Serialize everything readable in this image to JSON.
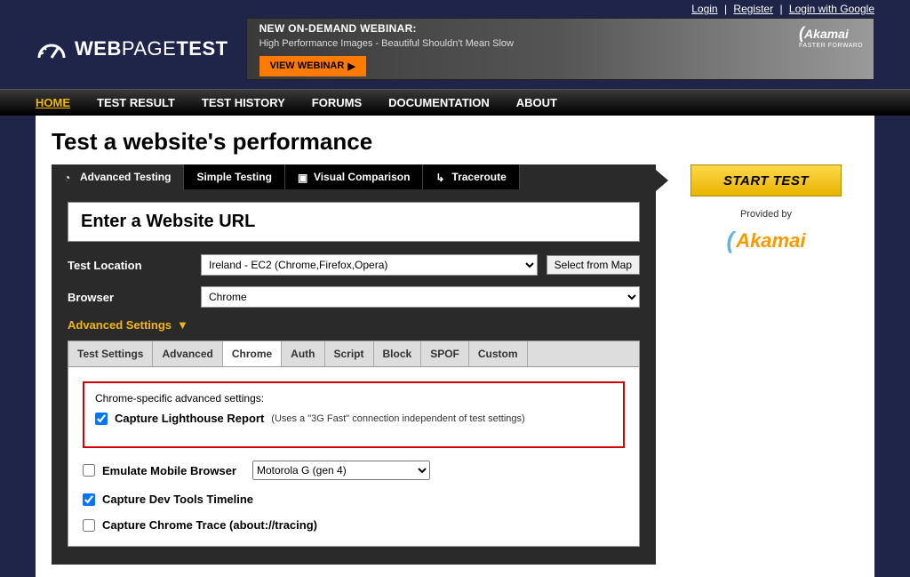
{
  "toplinks": {
    "login": "Login",
    "register": "Register",
    "google": "Login with Google"
  },
  "logo": {
    "web": "WEB",
    "page": "PAGE",
    "test": "TEST"
  },
  "banner": {
    "title": "NEW ON-DEMAND WEBINAR:",
    "subtitle": "High Performance Images - Beautiful Shouldn't Mean Slow",
    "button": "VIEW WEBINAR",
    "brand": "Akamai",
    "brand_tag": "FASTER FORWARD"
  },
  "nav": [
    "HOME",
    "TEST RESULT",
    "TEST HISTORY",
    "FORUMS",
    "DOCUMENTATION",
    "ABOUT"
  ],
  "nav_active_index": 0,
  "page_title": "Test a website's performance",
  "modetabs": [
    "Advanced Testing",
    "Simple Testing",
    "Visual Comparison",
    "Traceroute"
  ],
  "modetab_active_index": 0,
  "form": {
    "url_placeholder": "Enter a Website URL",
    "location_label": "Test Location",
    "location_value": "Ireland - EC2 (Chrome,Firefox,Opera)",
    "map_button": "Select from Map",
    "browser_label": "Browser",
    "browser_value": "Chrome",
    "advanced_label": "Advanced Settings"
  },
  "subtabs": [
    "Test Settings",
    "Advanced",
    "Chrome",
    "Auth",
    "Script",
    "Block",
    "SPOF",
    "Custom"
  ],
  "subtab_active_index": 2,
  "chrome_panel": {
    "heading": "Chrome-specific advanced settings:",
    "lighthouse_label": "Capture Lighthouse Report",
    "lighthouse_hint": "(Uses a \"3G Fast\" connection independent of test settings)",
    "lighthouse_checked": true,
    "emulate_label": "Emulate Mobile Browser",
    "emulate_checked": false,
    "emulate_value": "Motorola G (gen 4)",
    "devtools_label": "Capture Dev Tools Timeline",
    "devtools_checked": true,
    "trace_label": "Capture Chrome Trace (about://tracing)",
    "trace_checked": false
  },
  "sidebar": {
    "start": "START TEST",
    "provided": "Provided by",
    "sponsor": "Akamai"
  }
}
